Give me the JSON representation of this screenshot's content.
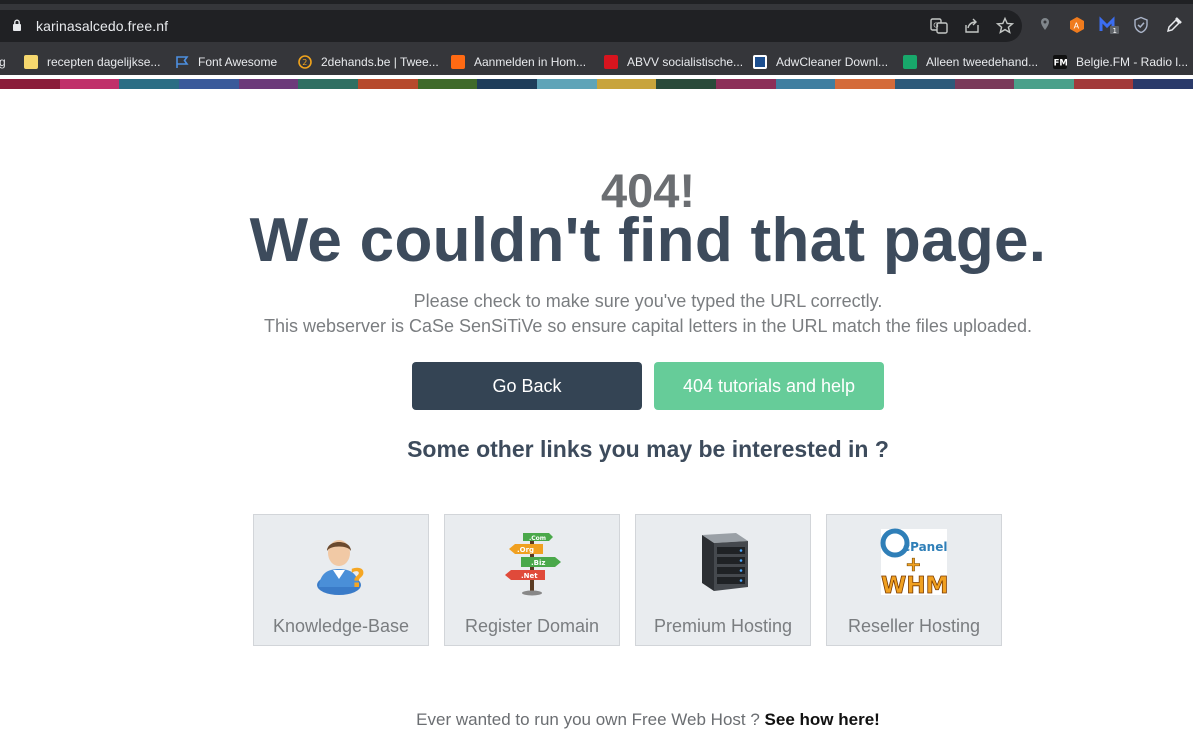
{
  "browser": {
    "url": "karinasalcedo.free.nf",
    "bookmarks": [
      {
        "label": "g",
        "icon": "bookmark-fragment-icon"
      },
      {
        "label": "recepten dagelijkse...",
        "icon": "folder-icon"
      },
      {
        "label": "Font Awesome",
        "icon": "flag-icon"
      },
      {
        "label": "2dehands.be | Twee...",
        "icon": "2dehands-icon"
      },
      {
        "label": "Aanmelden in Hom...",
        "icon": "homebanking-icon"
      },
      {
        "label": "ABVV socialistische...",
        "icon": "abvv-icon"
      },
      {
        "label": "AdwCleaner Downl...",
        "icon": "adwcleaner-icon"
      },
      {
        "label": "Alleen tweedehand...",
        "icon": "tweedehands-icon"
      },
      {
        "label": "Belgie.FM - Radio l...",
        "icon": "belgiefm-icon"
      }
    ],
    "extension_badge": "1",
    "extension_letter": "A",
    "fm_logo_text": "FM"
  },
  "page": {
    "code": "404!",
    "headline": "We couldn't find that page.",
    "hint_line1": "Please check to make sure you've typed the URL correctly.",
    "hint_line2": "This webserver is CaSe SenSiTiVe so ensure capital letters in the URL match the files uploaded.",
    "go_back_label": "Go Back",
    "help_label": "404 tutorials and help",
    "subhead": "Some other links you may be interested in ?",
    "links": [
      {
        "label": "Knowledge-Base",
        "icon": "support-person-icon"
      },
      {
        "label": "Register Domain",
        "icon": "domain-signpost-icon",
        "sign_labels": [
          ".Com",
          ".Org",
          ".Biz",
          ".Net"
        ]
      },
      {
        "label": "Premium Hosting",
        "icon": "server-icon"
      },
      {
        "label": "Reseller Hosting",
        "icon": "cpanel-whm-icon",
        "logo_text": [
          "cPanel",
          "+",
          "WHM"
        ]
      }
    ],
    "footer_text": "Ever wanted to run you own Free Web Host ?",
    "footer_link": "See how here!"
  },
  "colors": {
    "chrome_bg": "#35363a",
    "omnibox_bg": "#202124",
    "headline": "#3d4b5c",
    "go_back_bg": "#344454",
    "help_bg": "#66cc99",
    "card_bg": "#e9ecef",
    "stripe": [
      "#8a1c3a",
      "#c0306a",
      "#2b6d84",
      "#3a5a9a",
      "#6c3a7a",
      "#2f6f62",
      "#b64a2c",
      "#3f6a2a",
      "#1e3d5a",
      "#5fa4b8",
      "#c8a43c",
      "#2a4a3a",
      "#8c2f58",
      "#3f7ea0",
      "#d46b3a",
      "#2d5a7a",
      "#7a3a5a",
      "#4aa08a",
      "#a23a3a",
      "#2a3a6a"
    ]
  }
}
